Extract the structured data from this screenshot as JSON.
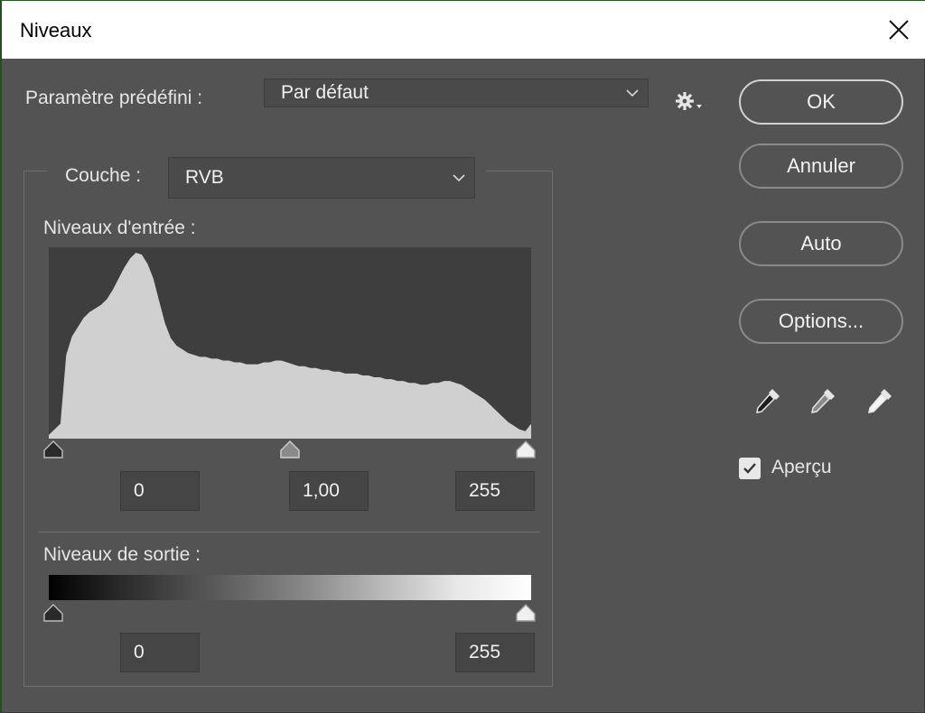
{
  "window": {
    "title": "Niveaux"
  },
  "preset": {
    "label": "Paramètre prédéfini :",
    "value": "Par défaut"
  },
  "channel": {
    "label": "Couche :",
    "value": "RVB"
  },
  "input_levels": {
    "label": "Niveaux d'entrée :",
    "black": "0",
    "gamma": "1,00",
    "white": "255"
  },
  "output_levels": {
    "label": "Niveaux de sortie :",
    "black": "0",
    "white": "255"
  },
  "buttons": {
    "ok": "OK",
    "cancel": "Annuler",
    "auto": "Auto",
    "options": "Options..."
  },
  "preview": {
    "label": "Aperçu",
    "checked": true
  },
  "histogram": {
    "counts": [
      0.02,
      0.05,
      0.08,
      0.45,
      0.55,
      0.6,
      0.65,
      0.68,
      0.7,
      0.72,
      0.75,
      0.8,
      0.86,
      0.92,
      0.97,
      1.0,
      0.99,
      0.94,
      0.86,
      0.74,
      0.62,
      0.54,
      0.5,
      0.48,
      0.46,
      0.45,
      0.44,
      0.44,
      0.43,
      0.43,
      0.42,
      0.42,
      0.41,
      0.41,
      0.4,
      0.4,
      0.4,
      0.41,
      0.41,
      0.42,
      0.42,
      0.41,
      0.4,
      0.39,
      0.39,
      0.38,
      0.38,
      0.37,
      0.37,
      0.36,
      0.36,
      0.35,
      0.35,
      0.35,
      0.34,
      0.34,
      0.33,
      0.33,
      0.32,
      0.32,
      0.31,
      0.31,
      0.3,
      0.3,
      0.29,
      0.29,
      0.3,
      0.3,
      0.31,
      0.31,
      0.3,
      0.29,
      0.27,
      0.25,
      0.23,
      0.21,
      0.18,
      0.15,
      0.12,
      0.09,
      0.07,
      0.05,
      0.04,
      0.08
    ]
  }
}
